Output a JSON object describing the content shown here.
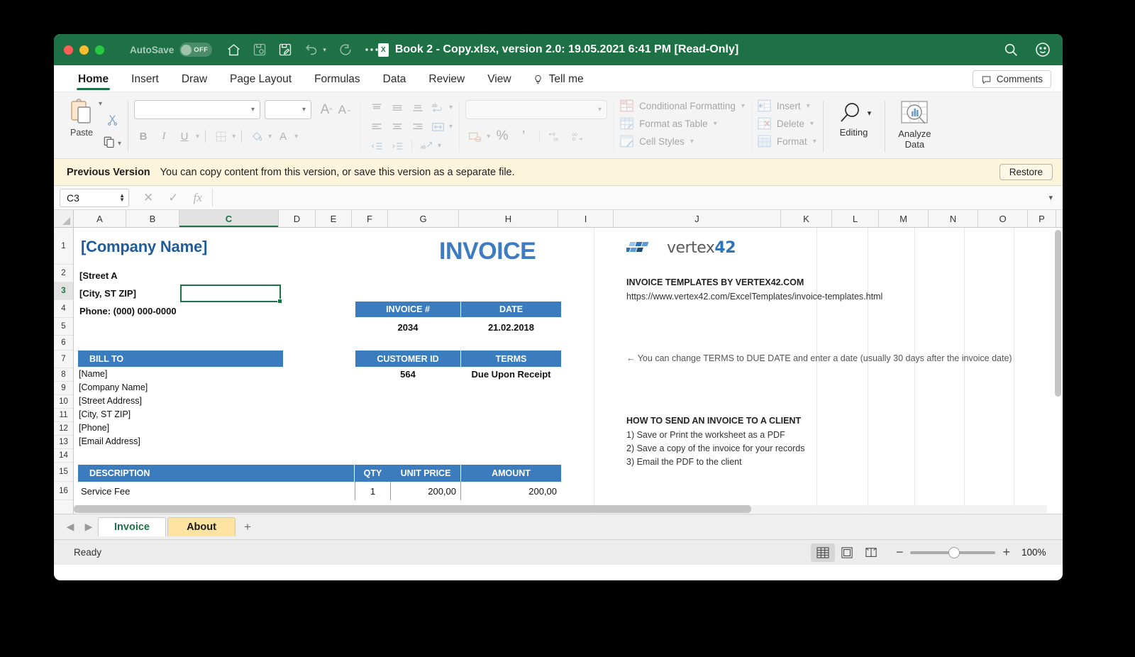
{
  "titlebar": {
    "autosave_label": "AutoSave",
    "autosave_state": "OFF",
    "document_title": "Book 2 - Copy.xlsx, version 2.0: 19.05.2021 6:41 PM  [Read-Only]",
    "icons": [
      "home-icon",
      "save-as-icon",
      "save-icon",
      "undo-icon",
      "redo-icon",
      "more-icon"
    ],
    "right_icons": [
      "search-icon",
      "account-icon"
    ]
  },
  "ribbon": {
    "tabs": [
      {
        "label": "Home",
        "active": true
      },
      {
        "label": "Insert",
        "active": false
      },
      {
        "label": "Draw",
        "active": false
      },
      {
        "label": "Page Layout",
        "active": false
      },
      {
        "label": "Formulas",
        "active": false
      },
      {
        "label": "Data",
        "active": false
      },
      {
        "label": "Review",
        "active": false
      },
      {
        "label": "View",
        "active": false
      }
    ],
    "tell_me": "Tell me",
    "comments": "Comments",
    "paste_label": "Paste",
    "font_name": "",
    "font_size": "",
    "number_format": "",
    "styles": [
      {
        "label": "Conditional Formatting"
      },
      {
        "label": "Format as Table"
      },
      {
        "label": "Cell Styles"
      }
    ],
    "cells": [
      {
        "label": "Insert"
      },
      {
        "label": "Delete"
      },
      {
        "label": "Format"
      }
    ],
    "editing_label": "Editing",
    "analyze_label": "Analyze\nData",
    "analyze_line1": "Analyze",
    "analyze_line2": "Data"
  },
  "notification": {
    "title": "Previous Version",
    "message": "You can copy content from this version, or save this version as a separate file.",
    "button": "Restore"
  },
  "formula_bar": {
    "name_box": "C3",
    "formula": "",
    "cancel_icon": "cancel-icon",
    "confirm_icon": "confirm-icon",
    "function_icon": "fx"
  },
  "grid": {
    "columns": [
      "A",
      "B",
      "C",
      "D",
      "E",
      "F",
      "G",
      "H",
      "I",
      "J",
      "K",
      "L",
      "M",
      "N",
      "O",
      "P"
    ],
    "selected_column": "C",
    "rows": [
      "1",
      "2",
      "3",
      "4",
      "5",
      "6",
      "7",
      "8",
      "9",
      "10",
      "11",
      "12",
      "13",
      "14",
      "15",
      "16"
    ],
    "selected_row": "3",
    "selected_cell": "C3"
  },
  "invoice": {
    "company_name": "[Company Name]",
    "street": "[Street A",
    "city_zip": "[City, ST ZIP]",
    "phone": "Phone: (000) 000-0000",
    "title": "INVOICE",
    "meta_table_1": {
      "headers": [
        "INVOICE #",
        "DATE"
      ],
      "values": [
        "2034",
        "21.02.2018"
      ]
    },
    "meta_table_2": {
      "headers": [
        "CUSTOMER ID",
        "TERMS"
      ],
      "values": [
        "564",
        "Due Upon Receipt"
      ]
    },
    "bill_to_header": "BILL TO",
    "bill_to_lines": [
      "[Name]",
      "[Company Name]",
      "[Street Address]",
      "[City, ST  ZIP]",
      "[Phone]",
      "[Email Address]"
    ],
    "items_headers": [
      "DESCRIPTION",
      "QTY",
      "UNIT PRICE",
      "AMOUNT"
    ],
    "items": [
      {
        "description": "Service Fee",
        "qty": "1",
        "unit_price": "200,00",
        "amount": "200,00"
      }
    ]
  },
  "sidepanel": {
    "logo_text_left": "vertex",
    "logo_text_right": "42",
    "heading": "INVOICE TEMPLATES BY VERTEX42.COM",
    "url": "https://www.vertex42.com/ExcelTemplates/invoice-templates.html",
    "terms_note": "← You can change TERMS to DUE DATE and enter a date (usually 30 days after the invoice date)",
    "howto_heading": "HOW TO SEND AN INVOICE TO A CLIENT",
    "howto_steps": [
      "1) Save or Print the worksheet as a PDF",
      "2) Save a copy of the invoice for your records",
      "3) Email the PDF to the client"
    ]
  },
  "sheet_tabs": {
    "tabs": [
      {
        "label": "Invoice",
        "active": true
      },
      {
        "label": "About",
        "active": false
      }
    ],
    "add_label": "+"
  },
  "status_bar": {
    "status": "Ready",
    "views": [
      "normal-view-icon",
      "page-layout-icon",
      "page-break-icon"
    ],
    "active_view": "normal-view-icon",
    "zoom_out": "−",
    "zoom_in": "+",
    "zoom_level": "100%"
  },
  "colors": {
    "titlebar_green": "#1E7145",
    "invoice_blue": "#3A7CBE",
    "company_blue": "#1F5C99",
    "notify_bg": "#FCF5DC",
    "about_tab": "#FCE3A0"
  }
}
